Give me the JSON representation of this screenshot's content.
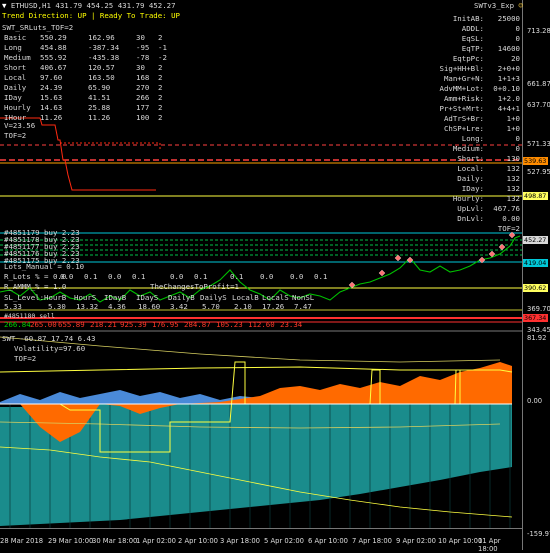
{
  "header": {
    "symbol_line": "ETHUSD,H1  431.79 454.25 431.79 452.27",
    "trend_line": "Trend Direction:  UP  |  Ready To Trade:  UP",
    "sub_line": "SWT_SRLuts_TOF=2",
    "right_title": "SWTv3_Exp"
  },
  "left_table": [
    {
      "label": "Basic",
      "a": "550.29",
      "b": "162.96",
      "c": "30",
      "d": "2"
    },
    {
      "label": "Long",
      "a": "454.88",
      "b": "-387.34",
      "c": "-95",
      "d": "-1"
    },
    {
      "label": "Medium",
      "a": "555.92",
      "b": "-435.38",
      "c": "-78",
      "d": "-2"
    },
    {
      "label": "Short",
      "a": "406.67",
      "b": "120.57",
      "c": "30",
      "d": "2"
    },
    {
      "label": "Local",
      "a": "97.60",
      "b": "163.50",
      "c": "168",
      "d": "2"
    },
    {
      "label": "Daily",
      "a": "24.39",
      "b": "65.90",
      "c": "270",
      "d": "2"
    },
    {
      "label": "IDay",
      "a": "15.63",
      "b": "41.51",
      "c": "266",
      "d": "2"
    },
    {
      "label": "Hourly",
      "a": "14.63",
      "b": "25.88",
      "c": "177",
      "d": "2"
    },
    {
      "label": "IHour",
      "a": "11.26",
      "b": "11.26",
      "c": "100",
      "d": "2"
    }
  ],
  "v_line": "V=23.56",
  "tof_line": "TOF=2",
  "right_table": [
    {
      "label": "InitAB:",
      "value": "25000"
    },
    {
      "label": "ADDL:",
      "value": "0"
    },
    {
      "label": "EqSL:",
      "value": "0"
    },
    {
      "label": "EqTP:",
      "value": "14600"
    },
    {
      "label": "EqtpPc:",
      "value": "20"
    },
    {
      "label": "Sig+HH+Bl:",
      "value": "2+0+0"
    },
    {
      "label": "Man+Gr+N:",
      "value": "1+1+3"
    },
    {
      "label": "AdvMM+Lot:",
      "value": "0+0.10"
    },
    {
      "label": "Amm+Risk:",
      "value": "1+2.0"
    },
    {
      "label": "Pr+St+Mrt:",
      "value": "4+4+1"
    },
    {
      "label": "AdTrS+Br:",
      "value": "1+0"
    },
    {
      "label": "ChSP+Lre:",
      "value": "1+0"
    },
    {
      "label": "Long:",
      "value": "0"
    },
    {
      "label": "Medium:",
      "value": "0"
    },
    {
      "label": "Short:",
      "value": "130"
    },
    {
      "label": "Local:",
      "value": "132"
    },
    {
      "label": "Daily:",
      "value": "132"
    },
    {
      "label": "IDay:",
      "value": "132"
    },
    {
      "label": "Hourly:",
      "value": "132"
    },
    {
      "label": "UpLvl:",
      "value": "467.76"
    },
    {
      "label": "DnLvl:",
      "value": "0.00"
    },
    {
      "label": "TOF=2",
      "value": ""
    }
  ],
  "orders": [
    "#4851179 buy 2.23",
    "#4851178 buy 2.23",
    "#4851177 buy 2.23",
    "#4851176 buy 2.23",
    "#4851175 buy 2.23"
  ],
  "lots_line": "Lots_Manual = 0.10",
  "rlots_line": "R_Lots % = 0.0",
  "ammm_line": "R_AMMM_% = 1.0",
  "changes_line": "TheChangesToProfit=1",
  "mid_values": [
    "0.0",
    "0.1",
    "0.0",
    "0.1",
    "0.0",
    "0.1",
    "0.1",
    "0.0",
    "0.0",
    "0.1"
  ],
  "sl_header": [
    "SL_Level:",
    "HourB",
    "HourS",
    "IDayB",
    "IDayS",
    "DailyB",
    "DailyS",
    "LocalB",
    "LocalS",
    "NonSL"
  ],
  "sl_values": [
    "5.33",
    "5.30",
    "13.32",
    "4.36",
    "18.60",
    "3.42",
    "5.70",
    "2.10",
    "17.26",
    "7.47"
  ],
  "bottom_row": [
    "266.84",
    "265.00",
    "655.89",
    "218.21",
    "925.39",
    "176.95",
    "284.87",
    "105.23",
    "112.60",
    "23.34"
  ],
  "sell_tag": "#4851180 sell",
  "price_axis": [
    "713.28",
    "661.87",
    "637.70",
    "571.33",
    "527.95",
    "498.87",
    "452.27",
    "419.04",
    "390.62",
    "369.70",
    "343.45"
  ],
  "price_tags": [
    {
      "text": "539.63",
      "color": "#ff8c00"
    },
    {
      "text": "498.87",
      "color": "#ffff60"
    },
    {
      "text": "452.27",
      "color": "#d8d8d8"
    },
    {
      "text": "419.04",
      "color": "#00c8d8"
    },
    {
      "text": "390.62",
      "color": "#ffff60"
    },
    {
      "text": "367.34",
      "color": "#ff3030"
    }
  ],
  "indicator": {
    "line1": "SWT -60.87 17.74 6.43",
    "line2": "Volatility=97.60",
    "line3": "TOF=2",
    "axis_top": "81.92",
    "axis_bottom": "-159.97"
  },
  "time_axis": [
    "28 Mar 2018",
    "29 Mar 10:00",
    "30 Mar 18:00",
    "1 Apr 02:00",
    "2 Apr 10:00",
    "3 Apr 18:00",
    "5 Apr 02:00",
    "6 Apr 10:00",
    "7 Apr 18:00",
    "9 Apr 02:00",
    "10 Apr 10:00",
    "11 Apr 18:00"
  ],
  "colors": {
    "bg": "#000000",
    "bull": "#00c000",
    "yellow": "#ffff00",
    "red": "#ff2020",
    "orange": "#ff6a00",
    "teal": "#1a8c8c",
    "blue": "#4a90e0"
  }
}
